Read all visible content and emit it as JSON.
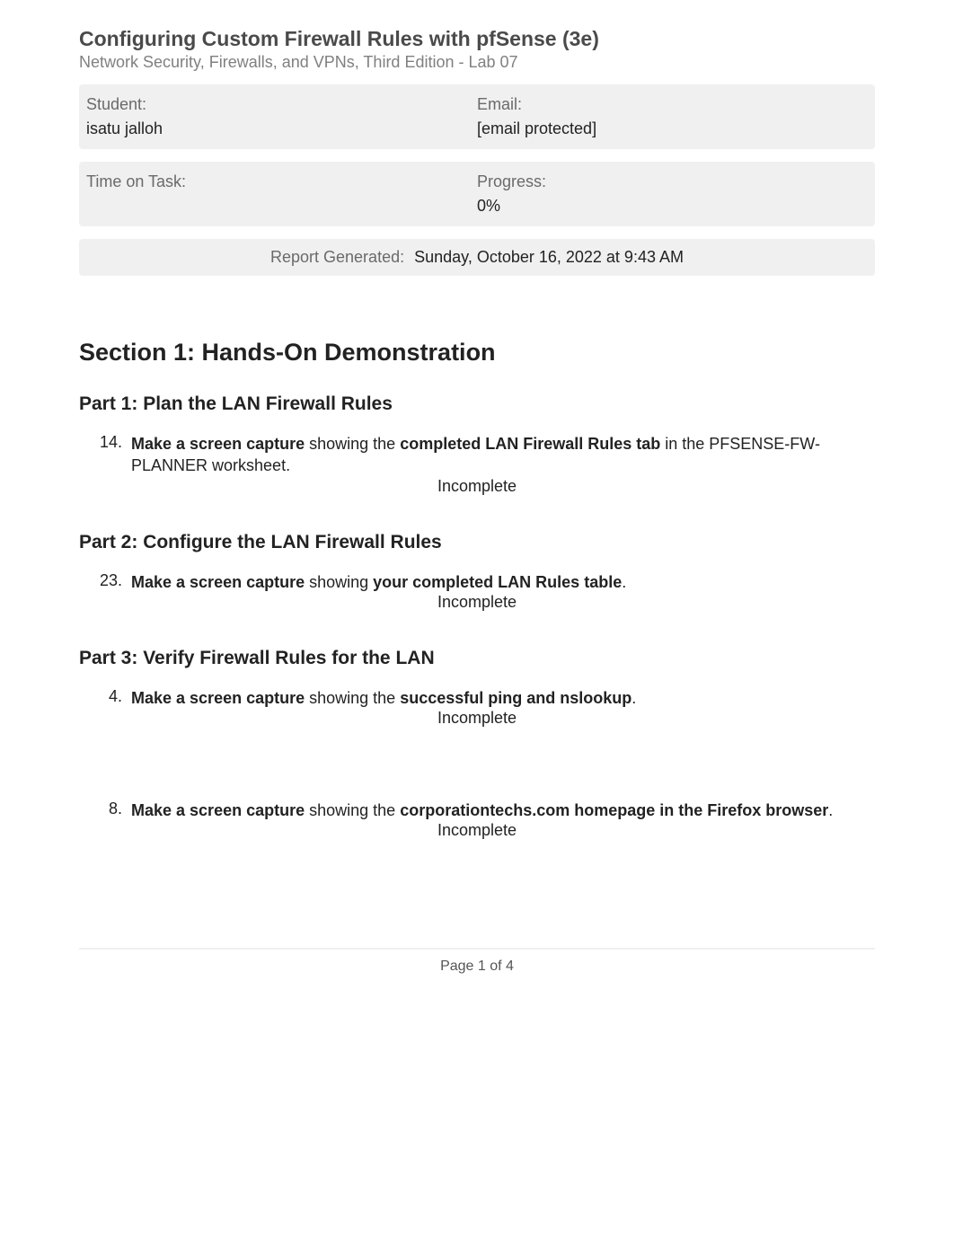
{
  "header": {
    "title": "Configuring Custom Firewall Rules with pfSense (3e)",
    "subtitle": "Network Security, Firewalls, and VPNs, Third Edition - Lab 07"
  },
  "info": {
    "student_label": "Student:",
    "student_value": "isatu jalloh",
    "email_label": "Email:",
    "email_value": "[email protected]",
    "time_label": "Time on Task:",
    "time_value": "",
    "progress_label": "Progress:",
    "progress_value": "0%"
  },
  "report": {
    "label": "Report Generated:",
    "value": "Sunday, October 16, 2022 at 9:43 AM"
  },
  "section": {
    "title": "Section 1: Hands-On Demonstration",
    "parts": [
      {
        "title": "Part 1: Plan the LAN Firewall Rules",
        "tasks": [
          {
            "number": "14.",
            "segments": [
              {
                "text": "Make a screen capture",
                "bold": true
              },
              {
                "text": " showing the ",
                "bold": false
              },
              {
                "text": "completed LAN Firewall Rules tab",
                "bold": true
              },
              {
                "text": " in the PFSENSE-FW-PLANNER worksheet.",
                "bold": false
              }
            ],
            "status": "Incomplete"
          }
        ]
      },
      {
        "title": "Part 2: Configure the LAN Firewall Rules",
        "tasks": [
          {
            "number": "23.",
            "segments": [
              {
                "text": "Make a screen capture",
                "bold": true
              },
              {
                "text": " showing ",
                "bold": false
              },
              {
                "text": "your completed LAN Rules table",
                "bold": true
              },
              {
                "text": ".",
                "bold": false
              }
            ],
            "status": "Incomplete"
          }
        ]
      },
      {
        "title": "Part 3: Verify Firewall Rules for the LAN",
        "tasks": [
          {
            "number": "4.",
            "segments": [
              {
                "text": "Make a screen capture",
                "bold": true
              },
              {
                "text": " showing the ",
                "bold": false
              },
              {
                "text": "successful ping and nslookup",
                "bold": true
              },
              {
                "text": ".",
                "bold": false
              }
            ],
            "status": "Incomplete"
          },
          {
            "number": "8.",
            "segments": [
              {
                "text": "Make a screen capture",
                "bold": true
              },
              {
                "text": " showing the ",
                "bold": false
              },
              {
                "text": "corporationtechs.com homepage in the Firefox browser",
                "bold": true
              },
              {
                "text": ".",
                "bold": false
              }
            ],
            "status": "Incomplete"
          }
        ]
      }
    ]
  },
  "footer": {
    "page": "Page 1 of 4"
  }
}
